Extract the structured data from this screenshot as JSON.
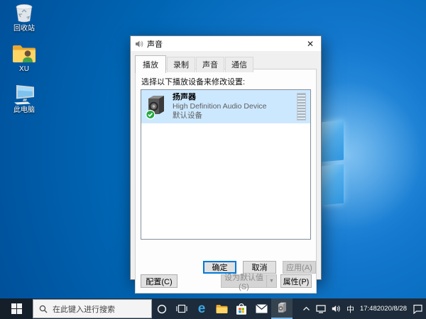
{
  "colors": {
    "accent": "#0078d7",
    "selection_blue": "#cce8ff",
    "desktop_blue": "#0063b1",
    "taskbar_dark": "#1d2b3a",
    "default_badge_green": "#23a83e"
  },
  "desktop": {
    "icons": [
      {
        "label": "回收站",
        "icon": "recycle-bin"
      },
      {
        "label": "XU",
        "icon": "user-folder"
      },
      {
        "label": "此电脑",
        "icon": "this-pc"
      }
    ]
  },
  "dialog": {
    "title": "声音",
    "close_glyph": "✕",
    "tabs": [
      {
        "label": "播放"
      },
      {
        "label": "录制"
      },
      {
        "label": "声音"
      },
      {
        "label": "通信"
      }
    ],
    "instruction": "选择以下播放设备来修改设置:",
    "device": {
      "name": "扬声器",
      "description": "High Definition Audio Device",
      "status": "默认设备"
    },
    "buttons": {
      "configure": "配置(C)",
      "set_default": "设为默认值(S)",
      "dropdown_glyph": "▼",
      "properties": "属性(P)",
      "ok": "确定",
      "cancel": "取消",
      "apply": "应用(A)"
    }
  },
  "taskbar": {
    "search_placeholder": "在此键入进行搜索",
    "tray": {
      "ime": "中",
      "time": "17:48",
      "date": "2020/8/28"
    }
  }
}
